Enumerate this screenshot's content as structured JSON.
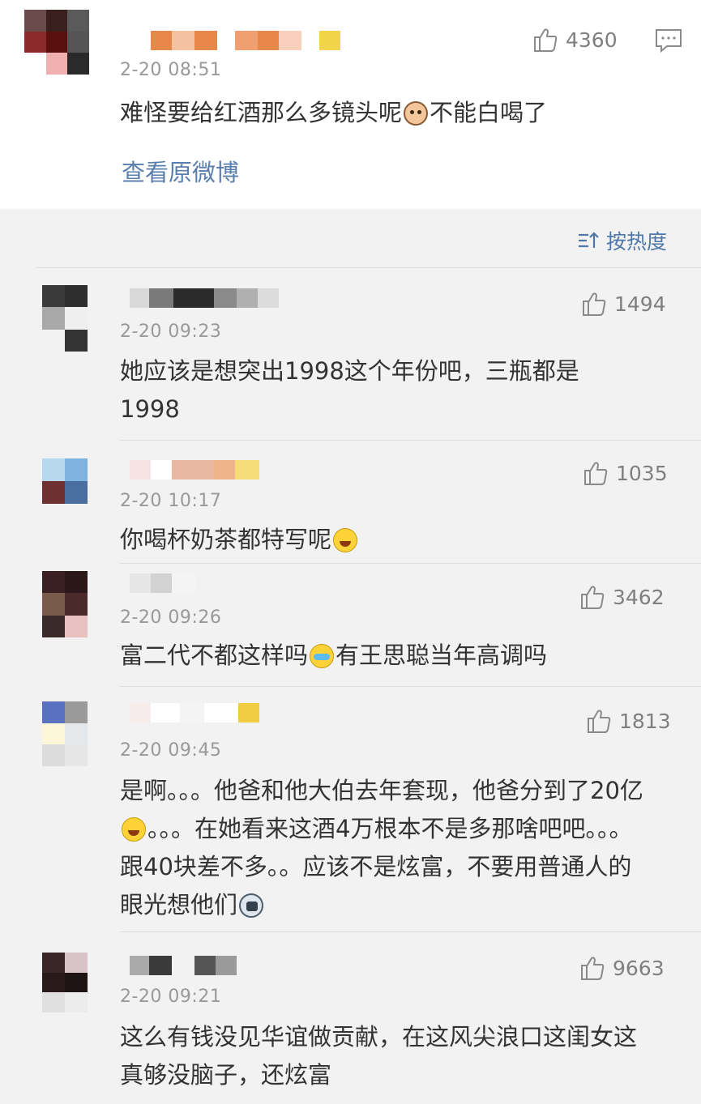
{
  "top_comment": {
    "time": "2-20 08:51",
    "likes": "4360",
    "text_before": "难怪要给红酒那么多镜头呢",
    "emoji": "cat-emoji",
    "text_after": "不能白喝了",
    "view_original": "查看原微博"
  },
  "sort": {
    "label": "按热度",
    "icon": "sort-icon"
  },
  "comments": [
    {
      "time": "2-20 09:23",
      "likes": "1494",
      "text": "她应该是想突出1998这个年份吧，三瓶都是1998"
    },
    {
      "time": "2-20 10:17",
      "likes": "1035",
      "text": "你喝杯奶茶都特写呢",
      "emoji": "laugh-cry-emoji"
    },
    {
      "time": "2-20 09:26",
      "likes": "3462",
      "text_before": "富二代不都这样吗",
      "emoji": "cry-emoji",
      "text_after": "有王思聪当年高调吗"
    },
    {
      "time": "2-20 09:45",
      "likes": "1813",
      "text_part1": "是啊。。。他爸和他大伯去年套现，他爸分到了20亿",
      "emoji1": "laugh-cry-emoji",
      "text_part2": "。。。在她看来这酒4万根本不是多那啥吧吧。。。跟40块差不多。。应该不是炫富，不要用普通人的眼光想他们",
      "emoji2": "husky-emoji"
    },
    {
      "time": "2-20 09:21",
      "likes": "9663",
      "text": "这么有钱没见华谊做贡献，在这风尖浪口这闺女这真够没脑子，还炫富"
    }
  ]
}
